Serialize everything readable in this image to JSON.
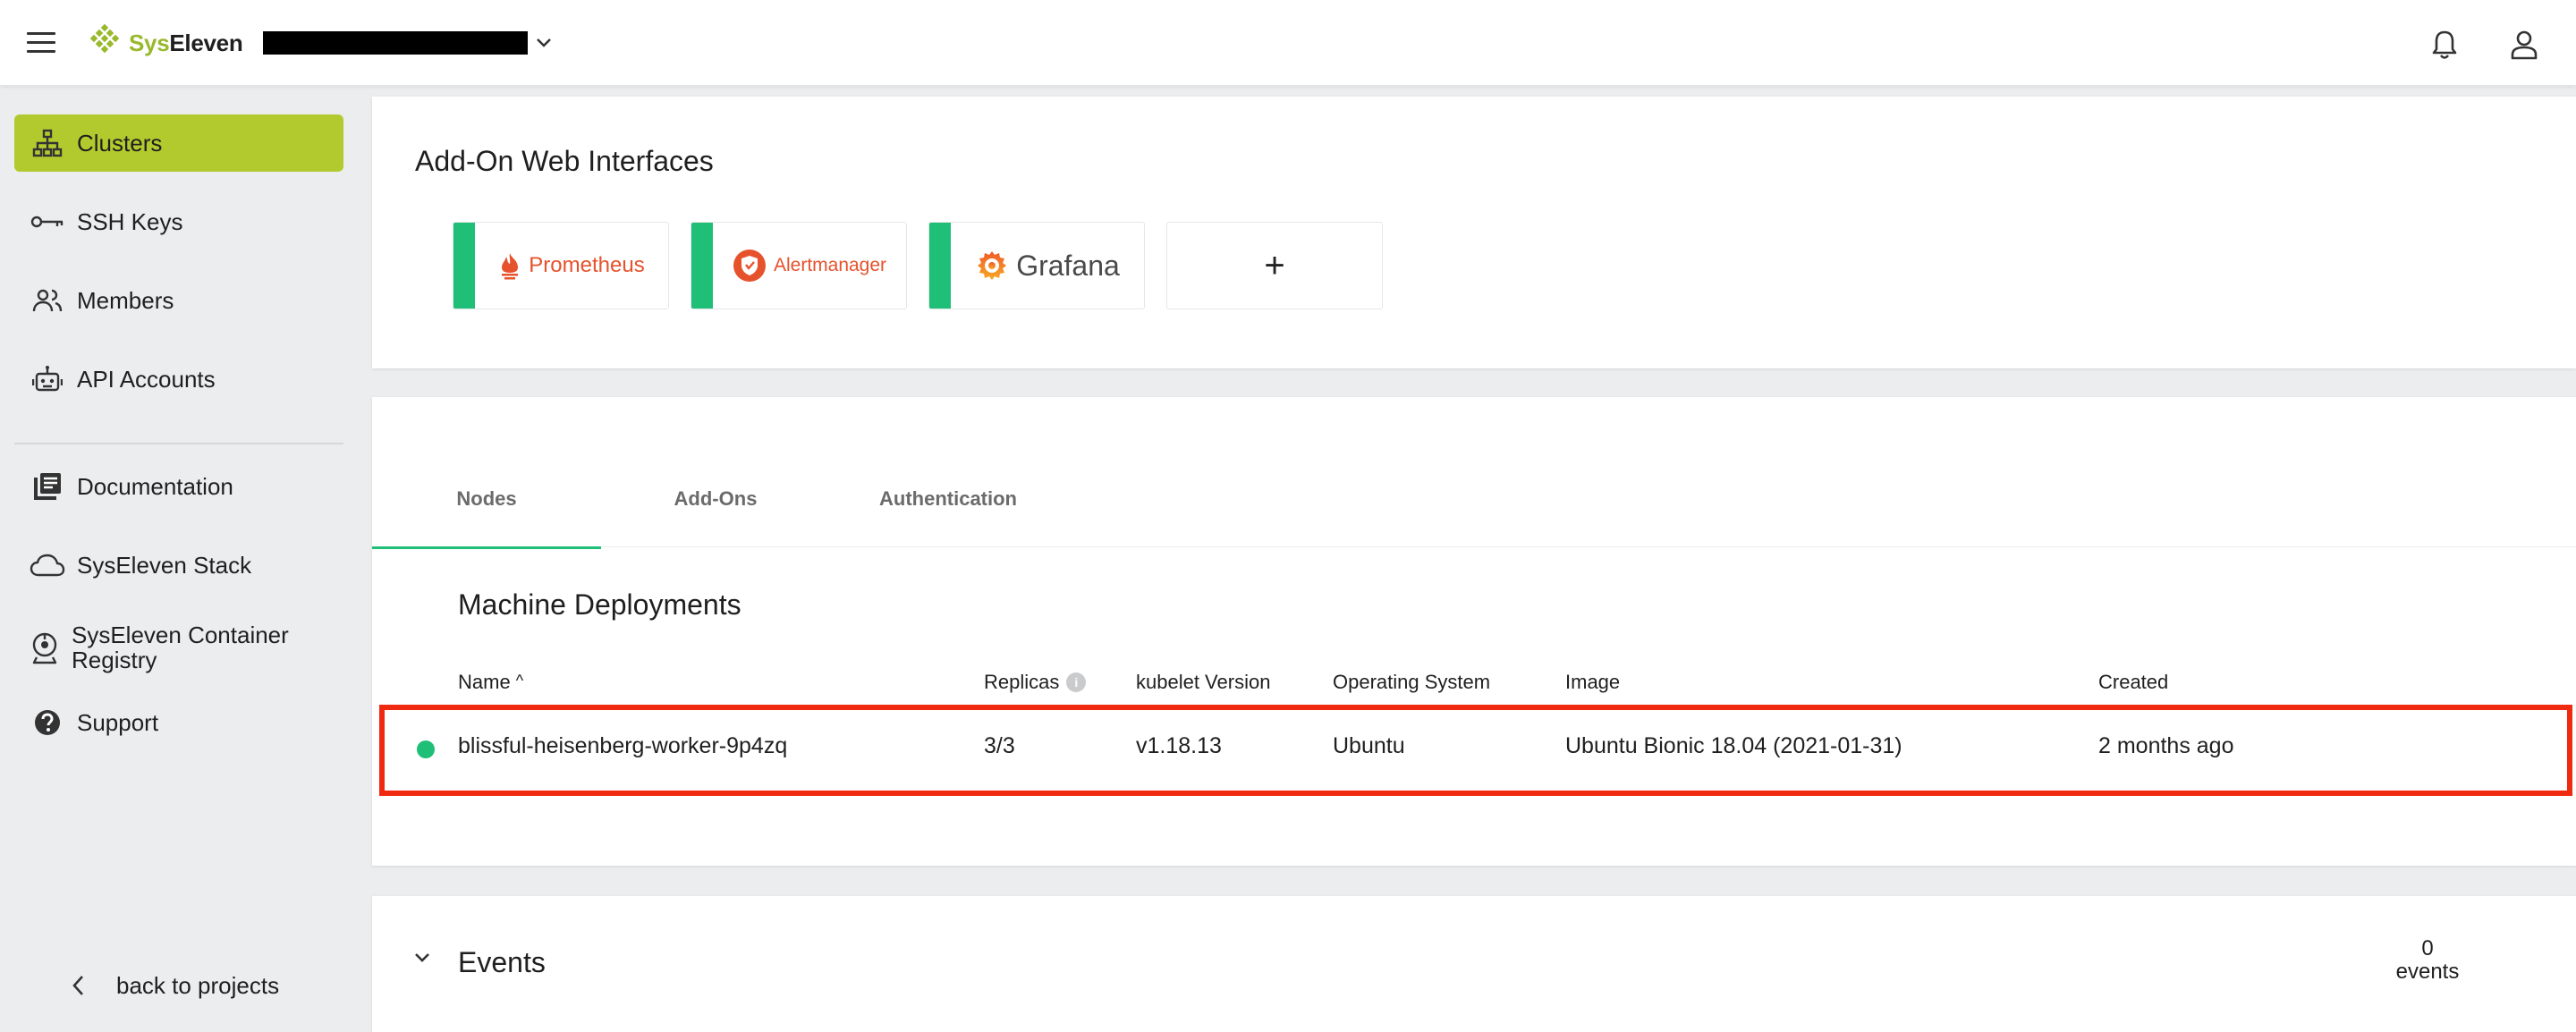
{
  "topbar": {
    "logo_prefix": "Sys",
    "logo_suffix": "Eleven",
    "icons": [
      "menu-icon",
      "bell-icon",
      "user-icon"
    ]
  },
  "sidebar": {
    "items": [
      {
        "label": "Clusters",
        "icon": "cluster-icon",
        "active": true
      },
      {
        "label": "SSH Keys",
        "icon": "key-icon"
      },
      {
        "label": "Members",
        "icon": "members-icon"
      },
      {
        "label": "API Accounts",
        "icon": "robot-icon"
      },
      {
        "label": "Documentation",
        "icon": "documentation-icon"
      },
      {
        "label": "SysEleven Stack",
        "icon": "cloud-icon"
      },
      {
        "label": "SysEleven Container Registry",
        "icon": "registry-icon"
      },
      {
        "label": "Support",
        "icon": "help-icon"
      }
    ],
    "back_label": "back to projects"
  },
  "addons": {
    "title": "Add-On Web Interfaces",
    "tiles": [
      {
        "label": "Prometheus"
      },
      {
        "label": "Alertmanager"
      },
      {
        "label": "Grafana"
      },
      {
        "label": "+"
      }
    ]
  },
  "tabs": [
    {
      "label": "Nodes",
      "active": true
    },
    {
      "label": "Add-Ons"
    },
    {
      "label": "Authentication"
    }
  ],
  "machine_deployments": {
    "title": "Machine Deployments",
    "columns": [
      "Name",
      "Replicas",
      "kubelet Version",
      "Operating System",
      "Image",
      "Created"
    ],
    "sort_indicator": "^",
    "info_icon": "i",
    "rows": [
      {
        "name": "blissful-heisenberg-worker-9p4zq",
        "replicas": "3/3",
        "kubelet_version": "v1.18.13",
        "os": "Ubuntu",
        "image": "Ubuntu Bionic 18.04 (2021-01-31)",
        "created": "2 months ago",
        "status_color": "#1fbf77"
      }
    ]
  },
  "events": {
    "title": "Events",
    "count": "0",
    "count_label": "events"
  },
  "colors": {
    "accent_green": "#b3ca2e",
    "status_green": "#1fbf77",
    "highlight_red": "#ef2a10"
  }
}
